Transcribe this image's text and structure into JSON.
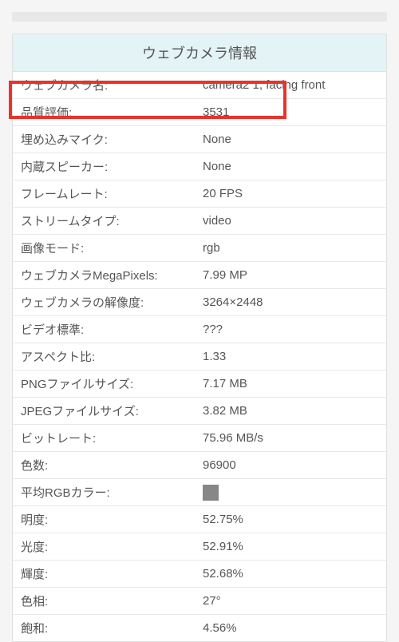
{
  "header": {
    "title": "ウェブカメラ情報"
  },
  "rows": [
    {
      "label": "ウェブカメラ名:",
      "value": "camera2 1, facing front"
    },
    {
      "label": "品質評価:",
      "value": "3531"
    },
    {
      "label": "埋め込みマイク:",
      "value": "None"
    },
    {
      "label": "内蔵スピーカー:",
      "value": "None"
    },
    {
      "label": "フレームレート:",
      "value": "20 FPS"
    },
    {
      "label": "ストリームタイプ:",
      "value": "video"
    },
    {
      "label": "画像モード:",
      "value": "rgb"
    },
    {
      "label": "ウェブカメラMegaPixels:",
      "value": "7.99 MP"
    },
    {
      "label": "ウェブカメラの解像度:",
      "value": "3264×2448"
    },
    {
      "label": "ビデオ標準:",
      "value": "???"
    },
    {
      "label": "アスペクト比:",
      "value": "1.33"
    },
    {
      "label": "PNGファイルサイズ:",
      "value": "7.17 MB"
    },
    {
      "label": "JPEGファイルサイズ:",
      "value": "3.82 MB"
    },
    {
      "label": "ビットレート:",
      "value": "75.96 MB/s"
    },
    {
      "label": "色数:",
      "value": "96900"
    },
    {
      "label": "平均RGBカラー:",
      "value": "",
      "swatch": true
    },
    {
      "label": "明度:",
      "value": "52.75%"
    },
    {
      "label": "光度:",
      "value": "52.91%"
    },
    {
      "label": "輝度:",
      "value": "52.68%"
    },
    {
      "label": "色相:",
      "value": "27°"
    },
    {
      "label": "飽和:",
      "value": "4.56%"
    }
  ]
}
